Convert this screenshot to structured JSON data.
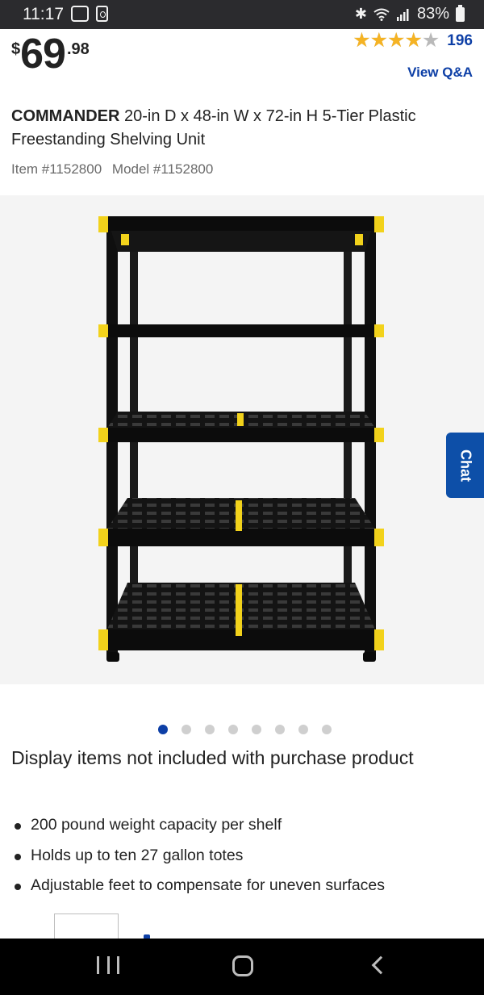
{
  "status_bar": {
    "time": "11:17",
    "battery_percent": "83%",
    "bluetooth_icon": "✱",
    "wifi_icon": "wifi-icon",
    "signal_icon": "signal-icon"
  },
  "price": {
    "currency": "$",
    "dollars": "69",
    "cents": ".98"
  },
  "rating": {
    "stars": 4.0,
    "max_stars": 5,
    "stars_glyphs": "★★★★★",
    "review_count": "196",
    "star_color": "#f5b324"
  },
  "view_qa": "View Q&A",
  "product": {
    "brand": "COMMANDER",
    "name": "20-in D x 48-in W x 72-in H 5-Tier Plastic Freestanding Shelving Unit",
    "item_number": "Item #1152800",
    "model_number": "Model #1152800"
  },
  "chat_label": "Chat",
  "carousel": {
    "total": 8,
    "active_index": 0
  },
  "display_note": "Display items not included with purchase product",
  "features": [
    "200 pound weight capacity per shelf",
    "Holds up to ten 27 gallon totes",
    "Adjustable feet to compensate for uneven surfaces"
  ],
  "colors": {
    "accent_blue": "#0d3fa6",
    "chat_blue": "#0d4fa8",
    "shelf_black": "#111111",
    "shelf_yellow": "#f2d21b"
  },
  "nav_icons": [
    "recents-icon",
    "home-icon",
    "back-icon"
  ]
}
